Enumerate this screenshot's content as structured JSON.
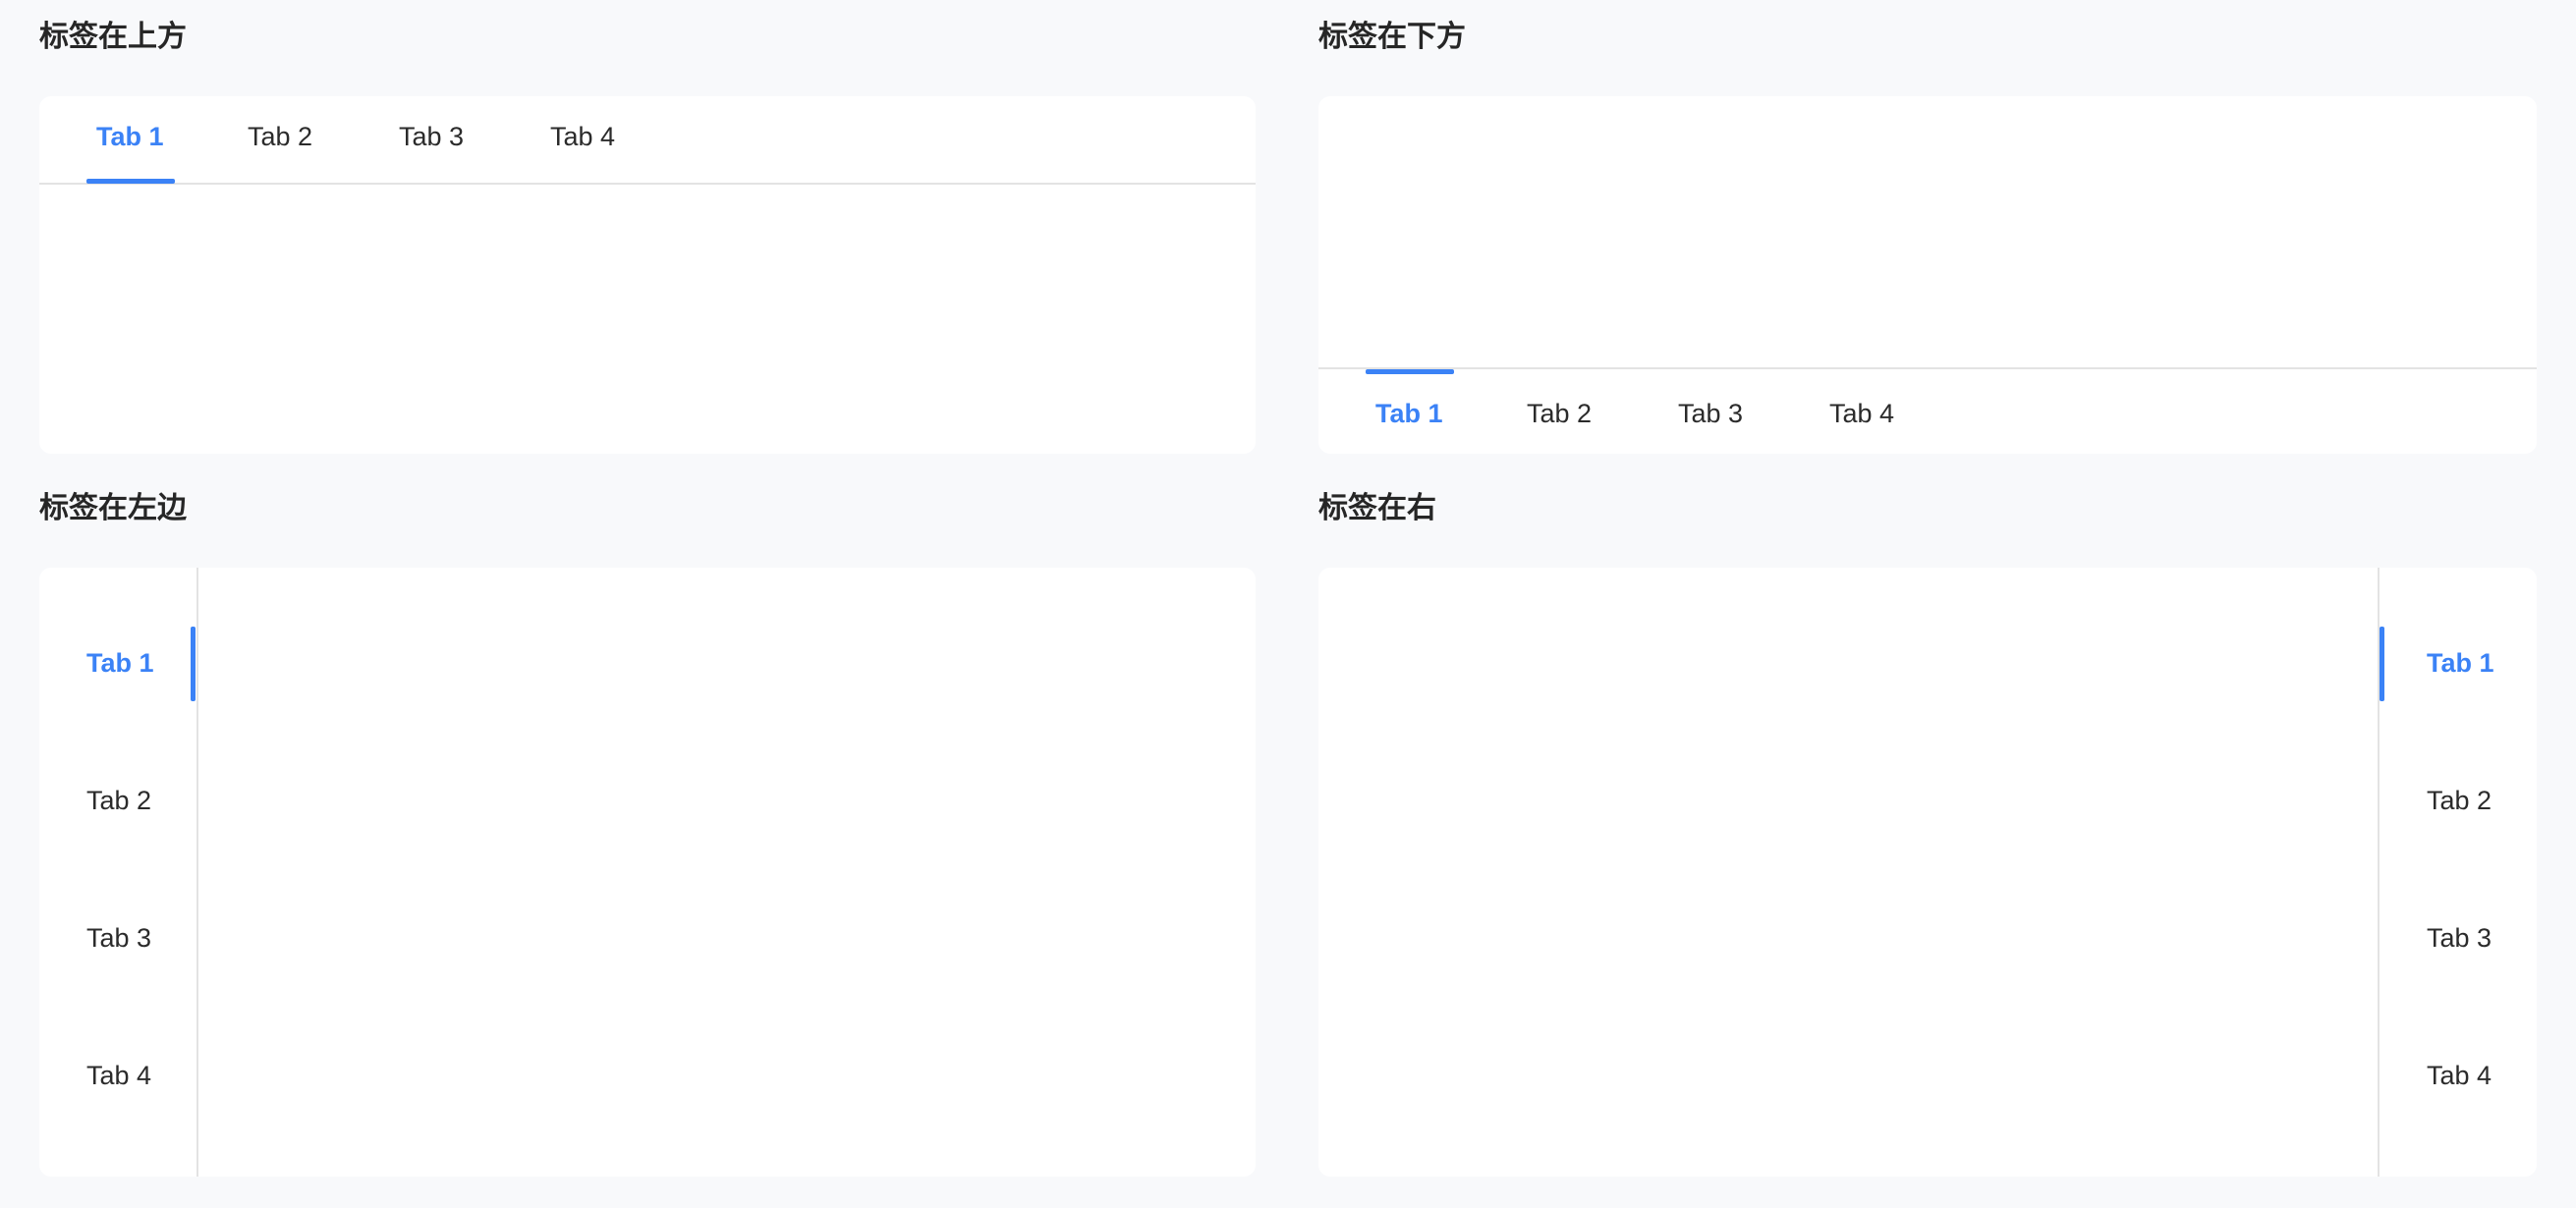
{
  "top_section": {
    "title": "标签在上方",
    "tabs": [
      {
        "label": "Tab 1"
      },
      {
        "label": "Tab 2"
      },
      {
        "label": "Tab 3"
      },
      {
        "label": "Tab 4"
      }
    ],
    "active_index": 0
  },
  "bottom_section": {
    "title": "标签在下方",
    "tabs": [
      {
        "label": "Tab 1"
      },
      {
        "label": "Tab 2"
      },
      {
        "label": "Tab 3"
      },
      {
        "label": "Tab 4"
      }
    ],
    "active_index": 0
  },
  "left_section": {
    "title": "标签在左边",
    "tabs": [
      {
        "label": "Tab 1"
      },
      {
        "label": "Tab 2"
      },
      {
        "label": "Tab 3"
      },
      {
        "label": "Tab 4"
      }
    ],
    "active_index": 0
  },
  "right_section": {
    "title": "标签在右",
    "tabs": [
      {
        "label": "Tab 1"
      },
      {
        "label": "Tab 2"
      },
      {
        "label": "Tab 3"
      },
      {
        "label": "Tab 4"
      }
    ],
    "active_index": 0
  },
  "colors": {
    "accent": "#3b82f6",
    "background": "#f8f9fb",
    "card": "#ffffff",
    "divider": "#e3e3e3",
    "text": "#2b2b2b"
  }
}
